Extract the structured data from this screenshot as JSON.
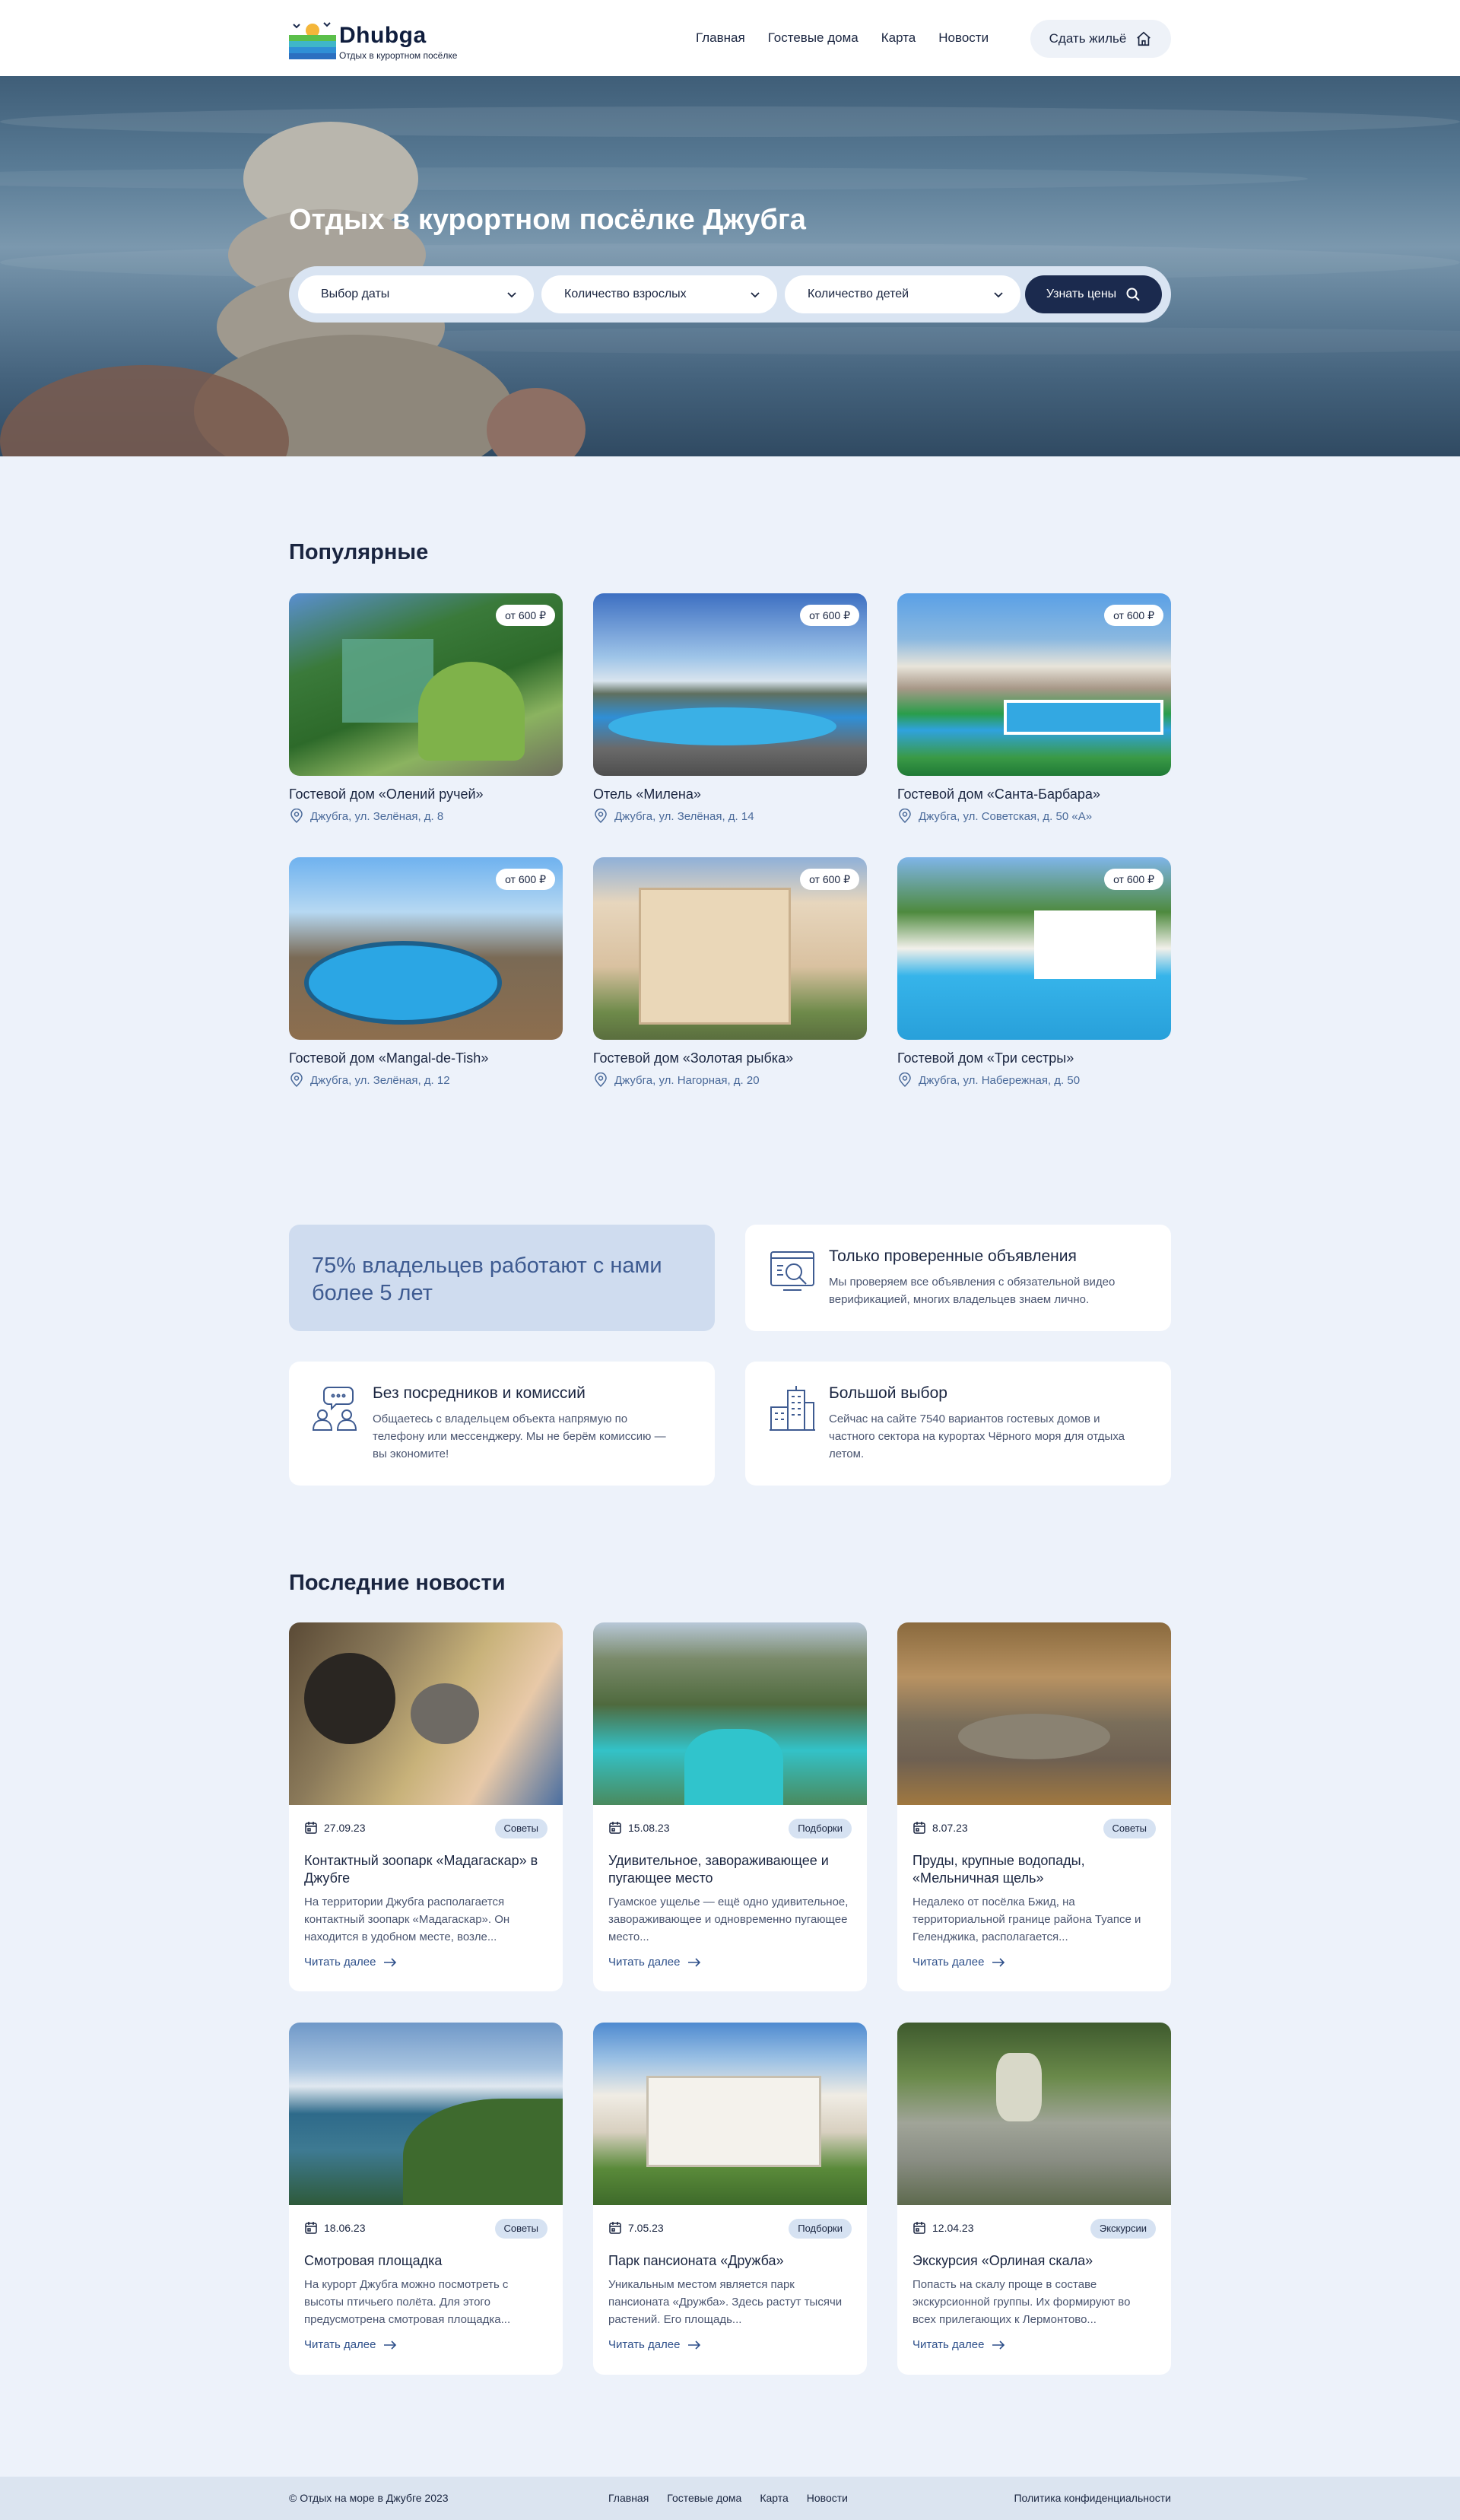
{
  "header": {
    "logo_title": "Dhubga",
    "logo_subtitle": "Отдых в курортном посёлке",
    "nav": [
      "Главная",
      "Гостевые дома",
      "Карта",
      "Новости"
    ],
    "rent_button": "Сдать жильё"
  },
  "hero": {
    "title": "Отдых в курортном посёлке Джубга",
    "date_select": "Выбор даты",
    "adults_select": "Количество взрослых",
    "children_select": "Количество детей",
    "price_button": "Узнать цены"
  },
  "popular": {
    "title": "Популярные",
    "items": [
      {
        "price": "от 600 ₽",
        "name": "Гостевой дом «Олений ручей»",
        "address": "Джубга, ул. Зелёная, д. 8"
      },
      {
        "price": "от 600 ₽",
        "name": "Отель «Милена»",
        "address": "Джубга, ул. Зелёная, д. 14"
      },
      {
        "price": "от 600 ₽",
        "name": "Гостевой дом «Санта-Барбара»",
        "address": "Джубга, ул. Советская, д. 50 «А»"
      },
      {
        "price": "от 600 ₽",
        "name": "Гостевой дом «Mangal-de-Tish»",
        "address": "Джубга, ул. Зелёная, д. 12"
      },
      {
        "price": "от 600 ₽",
        "name": "Гостевой дом «Золотая рыбка»",
        "address": "Джубга, ул. Нагорная, д. 20"
      },
      {
        "price": "от 600 ₽",
        "name": "Гостевой дом «Три сестры»",
        "address": "Джубга, ул. Набережная, д. 50"
      }
    ]
  },
  "features": {
    "highlight": "75% владельцев работают с нами более 5 лет",
    "items": [
      {
        "title": "Только проверенные объявления",
        "text": "Мы проверяем все объявления с обязательной видео верификацией, многих владельцев знаем лично.",
        "icon": "search-document-icon"
      },
      {
        "title": "Без посредников и комиссий",
        "text": "Общаетесь с владельцем объекта напрямую по телефону или мессенджеру. Мы не берём комиссию — вы экономите!",
        "icon": "people-chat-icon"
      },
      {
        "title": "Большой выбор",
        "text": "Сейчас на сайте 7540 вариантов гостевых домов и частного сектора на курортах Чёрного моря для отдыха летом.",
        "icon": "buildings-icon"
      }
    ]
  },
  "news": {
    "title": "Последние новости",
    "read_more": "Читать далее",
    "items": [
      {
        "date": "27.09.23",
        "tag": "Советы",
        "title": "Контактный зоопарк «Мадагаскар» в Джубге",
        "text": "На территории Джубга располагается контактный зоопарк «Мадагаскар». Он находится в удобном месте, возле..."
      },
      {
        "date": "15.08.23",
        "tag": "Подборки",
        "title": "Удивительное, завораживающее и пугающее место",
        "text": "Гуамское ущелье — ещё одно удивительное, завораживающее и одновременно пугающее место..."
      },
      {
        "date": "8.07.23",
        "tag": "Советы",
        "title": "Пруды, крупные водопады, «Мельничная щель»",
        "text": "Недалеко от посёлка Бжид, на территориальной границе района Туапсе и Геленджика, располагается..."
      },
      {
        "date": "18.06.23",
        "tag": "Советы",
        "title": "Смотровая площадка",
        "text": "На курорт Джубга можно посмотреть с высоты птичьего полёта. Для этого предусмотрена смотровая площадка..."
      },
      {
        "date": "7.05.23",
        "tag": "Подборки",
        "title": "Парк пансионата «Дружба»",
        "text": "Уникальным местом является парк пансионата «Дружба». Здесь растут тысячи растений. Его площадь..."
      },
      {
        "date": "12.04.23",
        "tag": "Экскурсии",
        "title": "Экскурсия «Орлиная скала»",
        "text": "Попасть на скалу проще в составе экскурсионной группы. Их формируют во всех прилегающих к Лермонтово..."
      }
    ]
  },
  "footer": {
    "copyright": "© Отдых на море в Джубге 2023",
    "nav": [
      "Главная",
      "Гостевые дома",
      "Карта",
      "Новости"
    ],
    "policy": "Политика конфиденциальности"
  },
  "colors": {
    "accent_dark": "#1b2a4e",
    "link": "#2d4f8a",
    "background": "#edf2fa",
    "highlight": "#cfdcef"
  }
}
